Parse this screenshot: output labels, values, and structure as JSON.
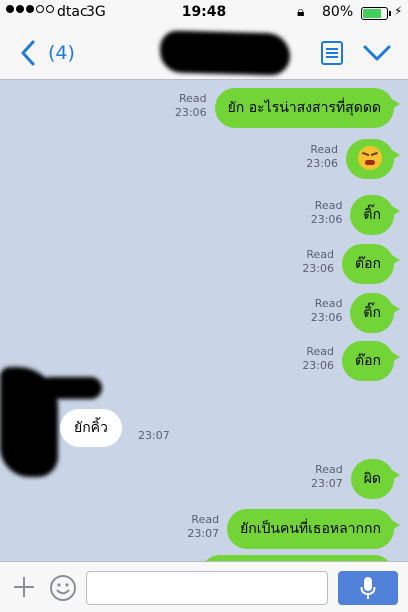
{
  "status_bar": {
    "signal_dots": [
      true,
      true,
      true,
      false,
      false
    ],
    "carrier": "dtac",
    "network": "3G",
    "time": "19:48",
    "battery_percent": "80%",
    "battery_level": 0.8
  },
  "nav": {
    "back_count": "(4)"
  },
  "messages_out": [
    {
      "status": "Read",
      "time": "23:06",
      "text": "ยัก อะไรน่าสงสารที่สุดดด"
    },
    {
      "status": "Read",
      "time": "23:06",
      "sticker": "tired-face-emoji"
    },
    {
      "status": "Read",
      "time": "23:06",
      "text": "ติ๊ก"
    },
    {
      "status": "Read",
      "time": "23:06",
      "text": "ต๊อก"
    },
    {
      "status": "Read",
      "time": "23:06",
      "text": "ติ๊ก"
    },
    {
      "status": "Read",
      "time": "23:06",
      "text": "ต๊อก"
    },
    {
      "status": "Read",
      "time": "23:07",
      "text": "ผิด"
    },
    {
      "status": "Read",
      "time": "23:07",
      "text": "ยักเป็นคนที่เธอหลากกก"
    }
  ],
  "message_in": {
    "text": "ยักคิ้ว",
    "time": "23:07"
  },
  "input": {
    "placeholder": ""
  },
  "colors": {
    "background": "#c9d4e6",
    "bubble_out": "#72d436",
    "bubble_in": "#ffffff",
    "accent": "#1f7ae0",
    "mic_button": "#4f82d8"
  }
}
